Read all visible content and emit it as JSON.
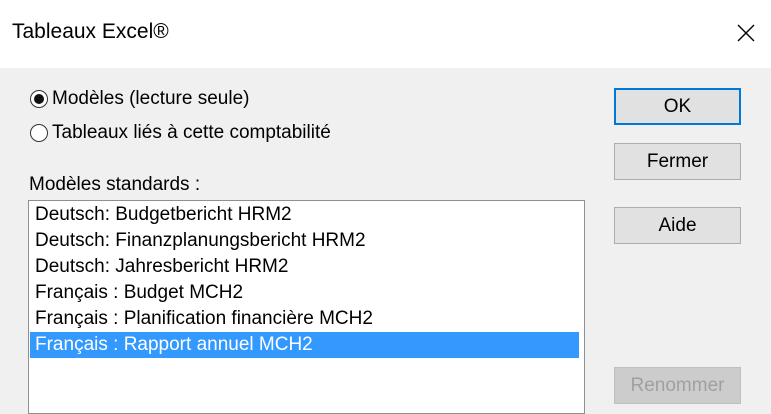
{
  "window": {
    "title": "Tableaux Excel®"
  },
  "title_bar": {
    "close_icon": "close-icon"
  },
  "options": {
    "templates_label": "Modèles (lecture seule)",
    "linked_label": "Tableaux liés à cette comptabilité",
    "selected": "templates"
  },
  "list": {
    "label": "Modèles standards :",
    "selected_index": 5,
    "items": [
      "Deutsch: Budgetbericht HRM2",
      "Deutsch: Finanzplanungsbericht HRM2",
      "Deutsch: Jahresbericht HRM2",
      "Français : Budget MCH2",
      "Français : Planification financière MCH2",
      "Français : Rapport annuel MCH2"
    ]
  },
  "buttons": {
    "ok": "OK",
    "close": "Fermer",
    "help": "Aide",
    "rename": "Renommer",
    "rename_enabled": false
  },
  "colors": {
    "selection": "#3399ff",
    "default_button_border": "#0078d7",
    "dialog_background": "#f0f0f0"
  }
}
